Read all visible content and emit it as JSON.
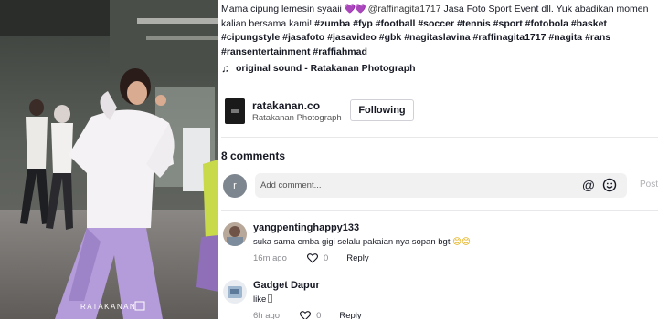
{
  "media": {
    "watermark": "RATAKANAN"
  },
  "caption": {
    "intro": "Mama cipung lemesin syaaii",
    "hearts": "💜💜",
    "mention": "@raffinagita1717",
    "body": "Jasa Foto Sport Event dll. Yuk abadikan momen kalian bersama kami!",
    "hashtags": [
      "#zumba",
      "#fyp",
      "#football",
      "#soccer",
      "#tennis",
      "#sport",
      "#fotobola",
      "#basket",
      "#cipungstyle",
      "#jasafoto",
      "#jasavideo",
      "#gbk",
      "#nagitaslavina",
      "#raffinagita1717",
      "#nagita",
      "#rans",
      "#ransentertainment",
      "#raffiahmad"
    ]
  },
  "sound": {
    "icon": "music-note-icon",
    "label": "original sound - Ratakanan Photograph"
  },
  "creator": {
    "handle": "ratakanan.co",
    "name": "Ratakanan Photograph",
    "separator": "·",
    "follow_label": "Following"
  },
  "comments_header": {
    "count_label": "8 comments"
  },
  "comment_input": {
    "avatar_letter": "r",
    "placeholder": "Add comment...",
    "mention_icon": "at-icon",
    "emoji_icon": "emoji-icon",
    "post_label": "Post"
  },
  "comments": [
    {
      "user": "yangpentinghappy133",
      "text": "suka sama emba gigi selalu pakaian nya sopan bgt",
      "emoji": "😊😊",
      "time": "16m ago",
      "likes": "0",
      "reply": "Reply"
    },
    {
      "user": "Gadget Dapur",
      "text": "like",
      "time": "6h ago",
      "likes": "0",
      "reply": "Reply"
    }
  ],
  "colors": {
    "text": "#161823",
    "muted": "#8a8b91",
    "input_bg": "#f1f1f2",
    "hearts": "#8a2be2"
  }
}
